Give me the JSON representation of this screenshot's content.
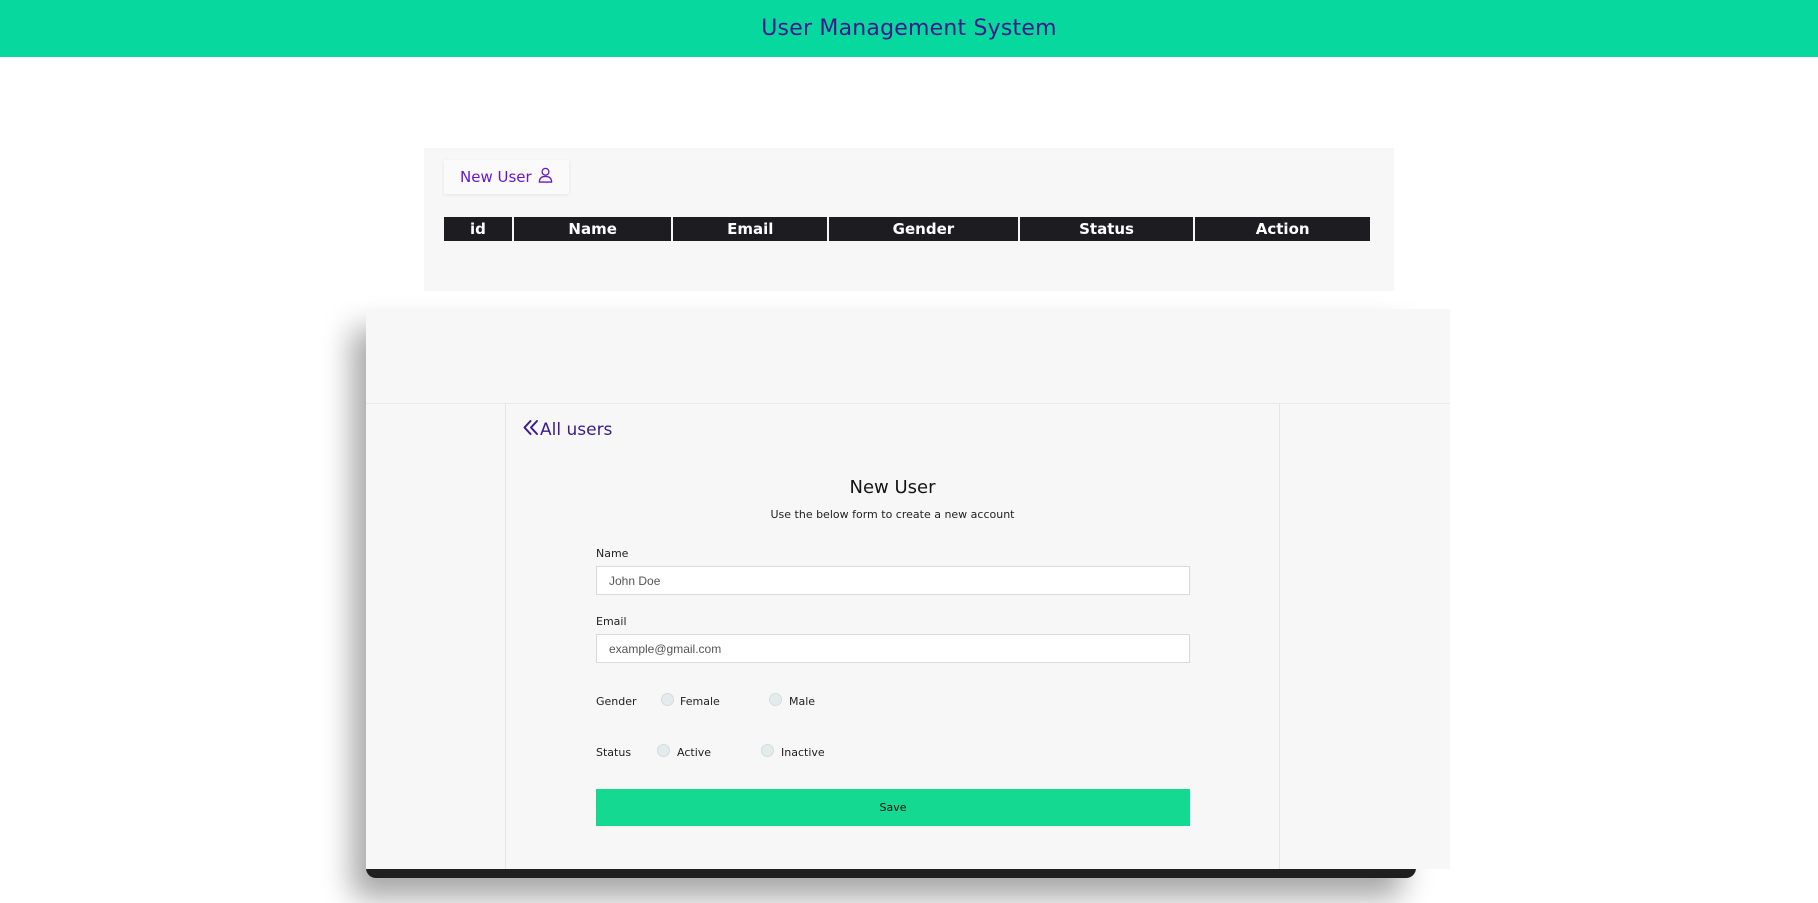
{
  "header": {
    "title": "User Management System"
  },
  "list": {
    "new_user_label": "New User",
    "columns": [
      "id",
      "Name",
      "Email",
      "Gender",
      "Status",
      "Action"
    ]
  },
  "form": {
    "back_label": "All users",
    "title": "New User",
    "subtitle": "Use the below form to create a new account",
    "name_label": "Name",
    "name_placeholder": "John Doe",
    "email_label": "Email",
    "email_placeholder": "example@gmail.com",
    "gender_label": "Gender",
    "gender_options": [
      "Female",
      "Male"
    ],
    "status_label": "Status",
    "status_options": [
      "Active",
      "Inactive"
    ],
    "save_label": "Save"
  },
  "colors": {
    "header_bg": "#07d89d",
    "header_text": "#3a1a8c",
    "accent_purple": "#6a17c9",
    "save_button": "#14d990",
    "table_header_bg": "#1d1c21"
  },
  "icons": {
    "new_user": "user-icon",
    "back": "double-chevron-left-icon"
  }
}
